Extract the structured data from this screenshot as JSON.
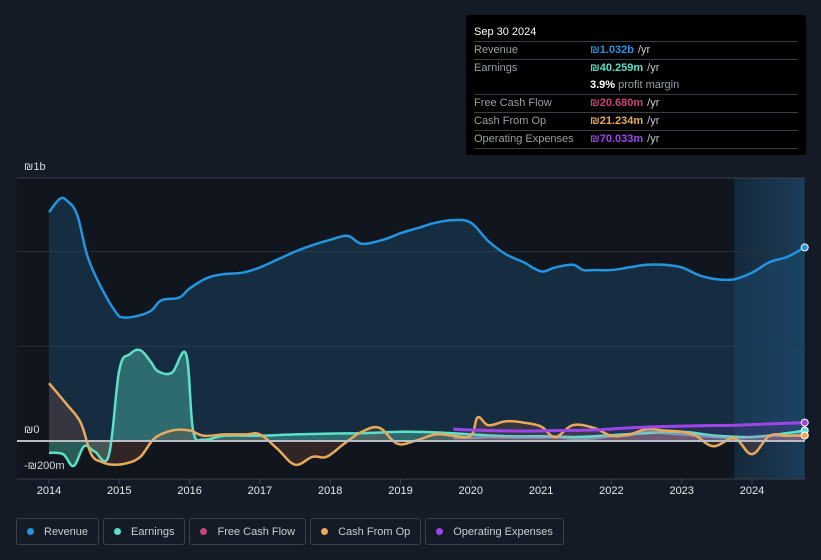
{
  "tooltip": {
    "date": "Sep 30 2024",
    "rows": [
      {
        "label": "Revenue",
        "value": "₪1.032b",
        "unit": "/yr",
        "color": "#2394df"
      },
      {
        "label": "Earnings",
        "value": "₪40.259m",
        "unit": "/yr",
        "color": "#5ce0c7"
      },
      {
        "label": "Free Cash Flow",
        "value": "₪20.680m",
        "unit": "/yr",
        "color": "#c9457f"
      },
      {
        "label": "Cash From Op",
        "value": "₪21.234m",
        "unit": "/yr",
        "color": "#e8a95a"
      },
      {
        "label": "Operating Expenses",
        "value": "₪70.033m",
        "unit": "/yr",
        "color": "#9d46e8"
      }
    ],
    "profit_margin_value": "3.9%",
    "profit_margin_label": "profit margin"
  },
  "legend": [
    {
      "label": "Revenue",
      "color": "#2394df"
    },
    {
      "label": "Earnings",
      "color": "#5ce0c7"
    },
    {
      "label": "Free Cash Flow",
      "color": "#c9457f"
    },
    {
      "label": "Cash From Op",
      "color": "#e8a95a"
    },
    {
      "label": "Operating Expenses",
      "color": "#9d46e8"
    }
  ],
  "chart_data": {
    "type": "area",
    "title": "",
    "xlabel": "",
    "ylabel": "",
    "y_tick_labels": [
      "₪1b",
      "₪0",
      "-₪200m"
    ],
    "x_tick_labels": [
      "2014",
      "2015",
      "2016",
      "2017",
      "2018",
      "2019",
      "2020",
      "2021",
      "2022",
      "2023",
      "2024"
    ],
    "xlim": [
      2014.0,
      2024.75
    ],
    "ylim": [
      -160,
      1000
    ],
    "units": "₪ millions (annualized)",
    "grid": true,
    "legend_position": "bottom",
    "highlight_range": [
      2023.75,
      2024.75
    ],
    "series": [
      {
        "name": "Revenue",
        "color": "#2394df",
        "x": [
          2014.0,
          2014.15,
          2014.25,
          2014.4,
          2014.55,
          2014.75,
          2014.95,
          2015.05,
          2015.25,
          2015.45,
          2015.6,
          2015.85,
          2016.0,
          2016.25,
          2016.5,
          2016.75,
          2017.0,
          2017.25,
          2017.5,
          2017.75,
          2018.0,
          2018.25,
          2018.45,
          2018.75,
          2019.0,
          2019.25,
          2019.5,
          2019.75,
          2020.0,
          2020.25,
          2020.5,
          2020.75,
          2021.0,
          2021.2,
          2021.45,
          2021.6,
          2021.75,
          2022.0,
          2022.25,
          2022.5,
          2022.75,
          2023.0,
          2023.25,
          2023.5,
          2023.75,
          2024.0,
          2024.25,
          2024.5,
          2024.75
        ],
        "values": [
          870,
          920,
          915,
          860,
          700,
          580,
          490,
          470,
          475,
          495,
          535,
          545,
          580,
          620,
          635,
          640,
          660,
          690,
          720,
          745,
          765,
          780,
          750,
          765,
          790,
          810,
          830,
          840,
          830,
          760,
          710,
          680,
          645,
          660,
          670,
          650,
          650,
          650,
          660,
          670,
          670,
          660,
          630,
          615,
          615,
          640,
          680,
          700,
          736
        ]
      },
      {
        "name": "Earnings",
        "color": "#5ce0c7",
        "x": [
          2014.0,
          2014.2,
          2014.35,
          2014.5,
          2014.65,
          2014.85,
          2015.0,
          2015.15,
          2015.3,
          2015.45,
          2015.55,
          2015.75,
          2015.95,
          2016.05,
          2016.2,
          2016.5,
          2017.0,
          2017.5,
          2018.0,
          2018.5,
          2019.0,
          2019.5,
          2020.0,
          2020.5,
          2021.0,
          2021.5,
          2022.0,
          2022.5,
          2023.0,
          2023.5,
          2024.0,
          2024.5,
          2024.75
        ],
        "values": [
          -45,
          -50,
          -95,
          -20,
          -40,
          -55,
          270,
          330,
          345,
          300,
          265,
          260,
          330,
          40,
          5,
          20,
          20,
          25,
          28,
          30,
          35,
          33,
          25,
          18,
          18,
          15,
          22,
          30,
          35,
          20,
          15,
          30,
          40
        ]
      },
      {
        "name": "Free Cash Flow",
        "color": "#c9457f",
        "x": [
          2019.75,
          2020.0,
          2020.25,
          2020.5,
          2020.75,
          2021.0,
          2021.25,
          2021.5,
          2021.75,
          2022.0,
          2022.25,
          2022.5,
          2022.75,
          2023.0,
          2023.25,
          2023.5,
          2023.75,
          2024.0,
          2024.25,
          2024.5,
          2024.75
        ],
        "values": [
          12,
          12,
          15,
          14,
          14,
          14,
          14,
          8,
          10,
          18,
          22,
          35,
          30,
          25,
          20,
          15,
          10,
          15,
          20,
          20,
          21
        ]
      },
      {
        "name": "Cash From Op",
        "color": "#e8a95a",
        "x": [
          2014.0,
          2014.25,
          2014.45,
          2014.6,
          2014.75,
          2014.9,
          2015.1,
          2015.3,
          2015.5,
          2015.75,
          2016.0,
          2016.2,
          2016.5,
          2016.8,
          2017.0,
          2017.25,
          2017.5,
          2017.75,
          2017.95,
          2018.2,
          2018.45,
          2018.7,
          2018.95,
          2019.2,
          2019.5,
          2019.75,
          2020.0,
          2020.1,
          2020.25,
          2020.5,
          2020.75,
          2021.0,
          2021.2,
          2021.45,
          2021.75,
          2022.0,
          2022.25,
          2022.5,
          2022.75,
          2023.0,
          2023.2,
          2023.45,
          2023.75,
          2024.0,
          2024.25,
          2024.5,
          2024.75
        ],
        "values": [
          220,
          140,
          70,
          -50,
          -80,
          -90,
          -85,
          -60,
          10,
          40,
          40,
          20,
          25,
          25,
          25,
          -30,
          -90,
          -60,
          -60,
          -10,
          35,
          50,
          -10,
          0,
          25,
          20,
          20,
          90,
          60,
          75,
          70,
          55,
          15,
          60,
          50,
          20,
          25,
          45,
          40,
          35,
          20,
          -20,
          10,
          -50,
          20,
          20,
          21
        ]
      },
      {
        "name": "Operating Expenses",
        "color": "#9d46e8",
        "x": [
          2019.75,
          2020.25,
          2020.75,
          2021.25,
          2021.75,
          2022.25,
          2022.75,
          2023.25,
          2023.75,
          2024.25,
          2024.75
        ],
        "values": [
          45,
          40,
          38,
          40,
          42,
          50,
          55,
          58,
          60,
          65,
          70
        ]
      }
    ]
  }
}
